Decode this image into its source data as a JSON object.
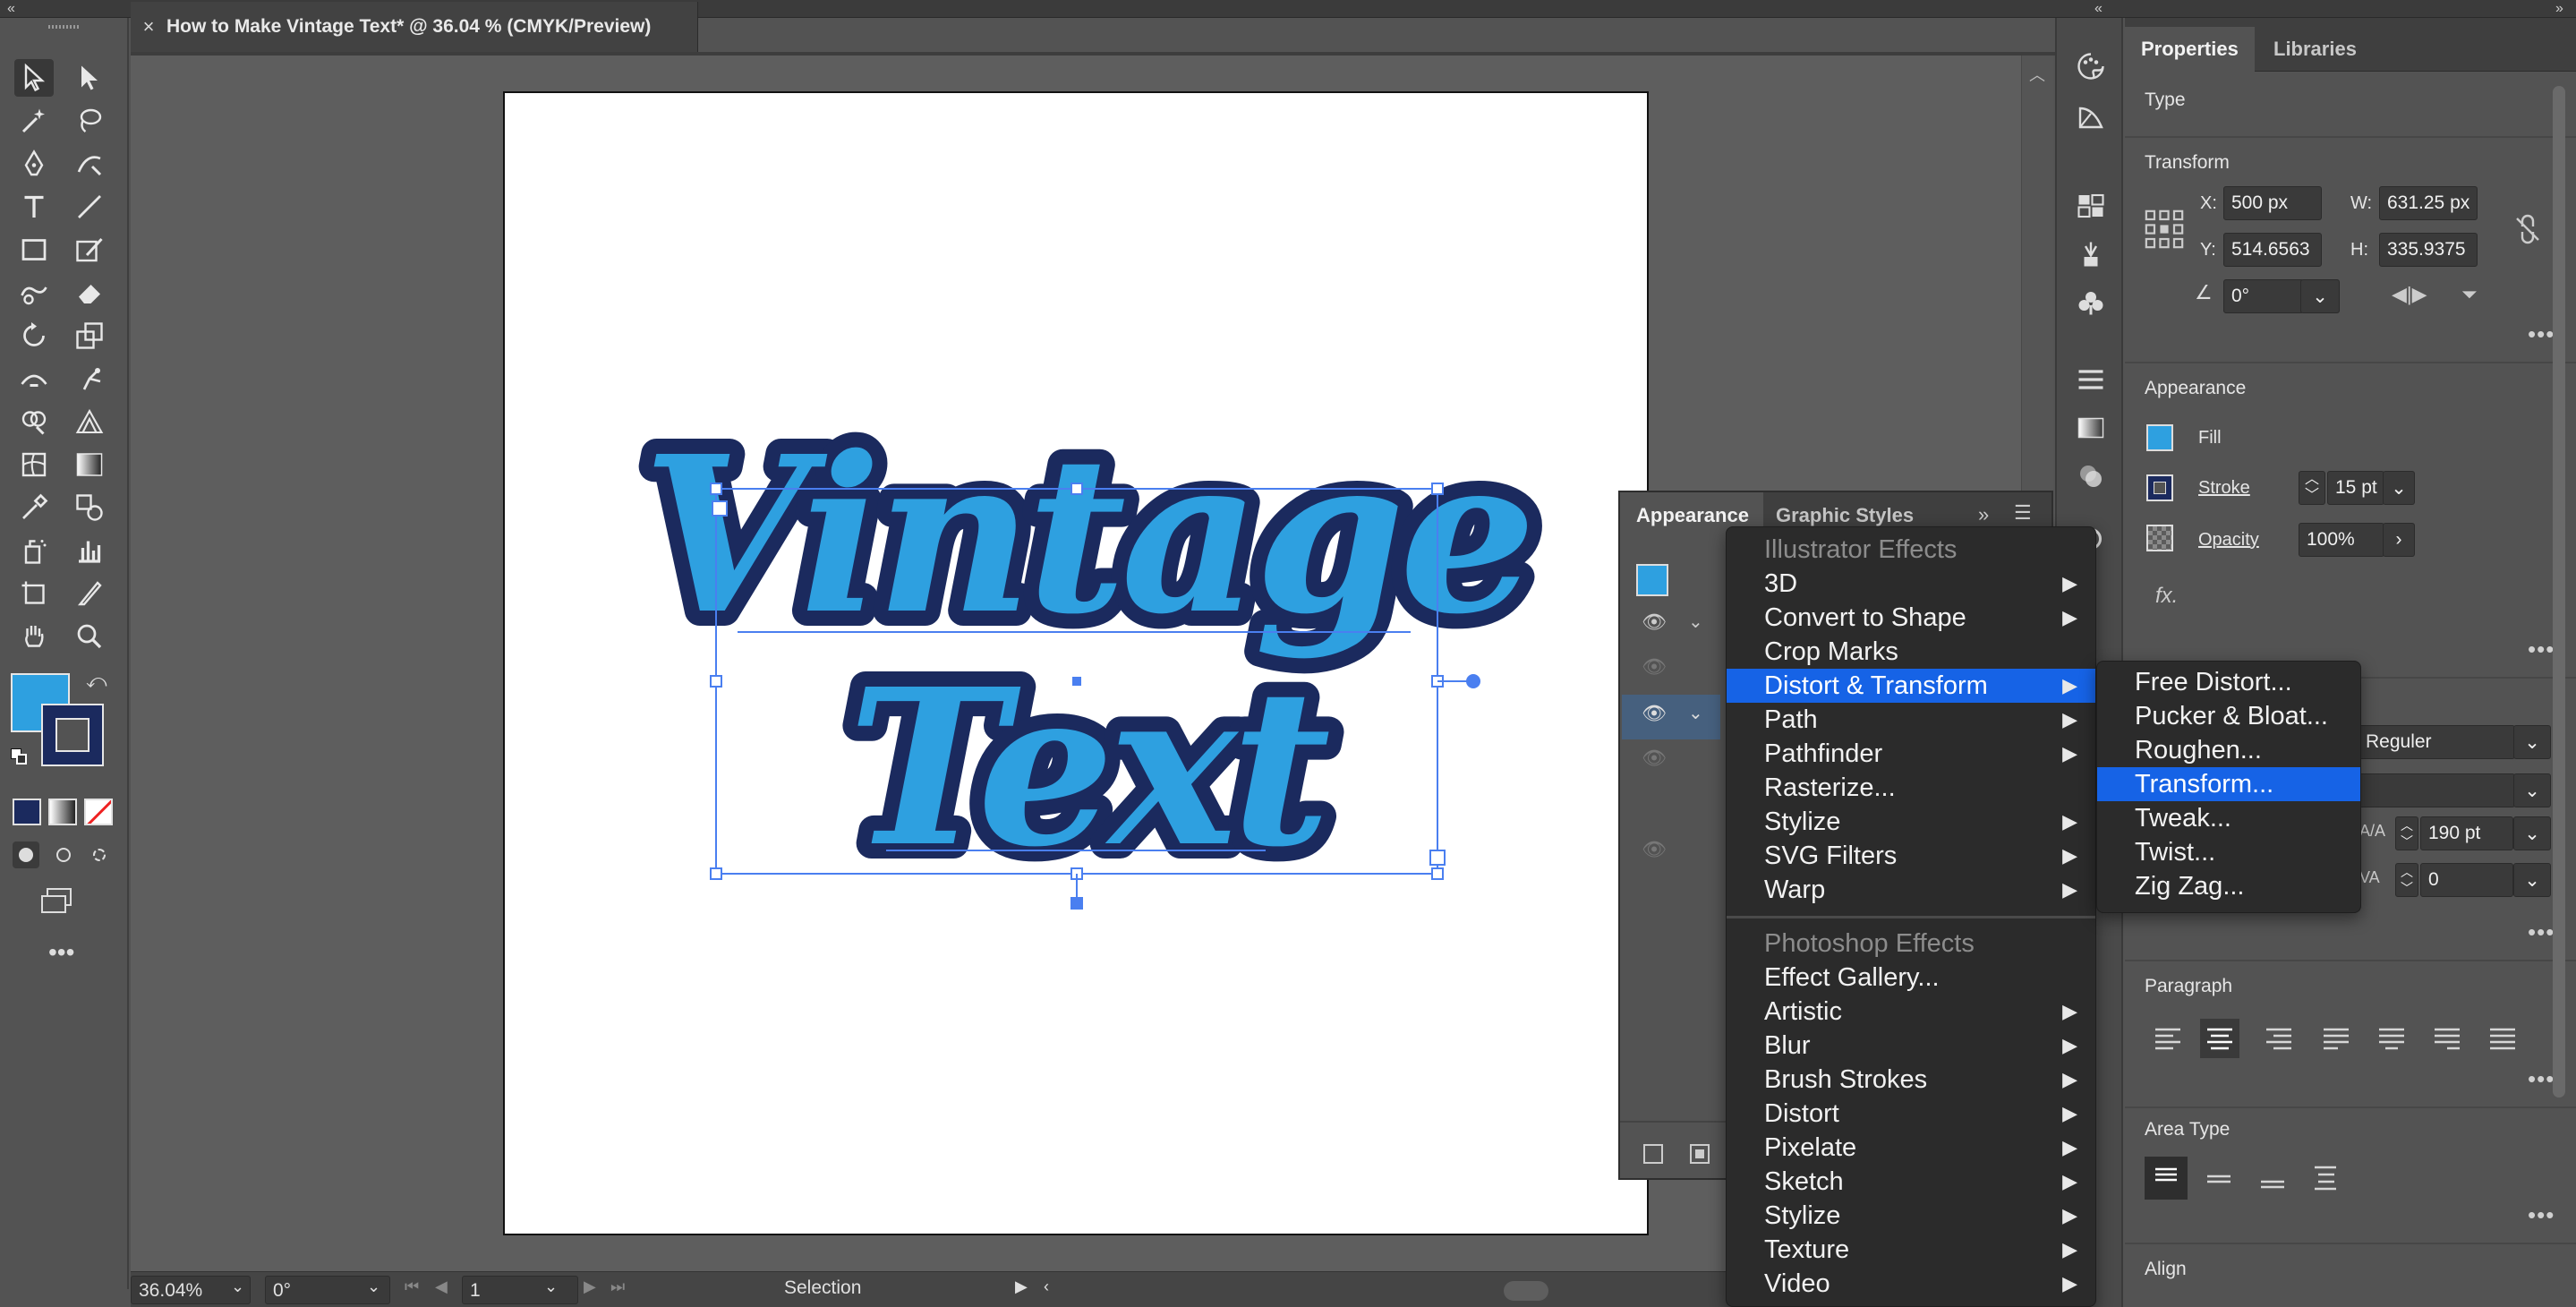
{
  "document": {
    "tab_title": "How to Make Vintage Text* @ 36.04 % (CMYK/Preview)",
    "close": "×"
  },
  "artwork": {
    "line1": "Vintage",
    "line2": "Text",
    "fill_color": "#2ea0e0",
    "stroke_color": "#1b2a5e"
  },
  "status_bar": {
    "zoom": "36.04%",
    "rotation": "0°",
    "artboard": "1",
    "tool": "Selection"
  },
  "properties": {
    "tabs": [
      "Properties",
      "Libraries"
    ],
    "type_label": "Type",
    "transform": {
      "title": "Transform",
      "x_label": "X:",
      "x": "500 px",
      "y_label": "Y:",
      "y": "514.6563",
      "w_label": "W:",
      "w": "631.25 px",
      "h_label": "H:",
      "h": "335.9375",
      "angle": "0°"
    },
    "appearance": {
      "title": "Appearance",
      "fill": "Fill",
      "stroke": "Stroke",
      "stroke_weight": "15 pt",
      "opacity": "Opacity",
      "opacity_value": "100%",
      "fx": "fx."
    },
    "character": {
      "font_style": "Reguler",
      "size": "190 pt",
      "tracking": "0"
    },
    "paragraph_title": "Paragraph",
    "area_type_title": "Area Type",
    "align_title": "Align"
  },
  "appearance_panel": {
    "tabs": [
      "Appearance",
      "Graphic Styles"
    ]
  },
  "effect_menu": {
    "illustrator_header": "Illustrator Effects",
    "illustrator_items": [
      {
        "label": "3D",
        "sub": true
      },
      {
        "label": "Convert to Shape",
        "sub": true
      },
      {
        "label": "Crop Marks",
        "sub": false
      },
      {
        "label": "Distort & Transform",
        "sub": true
      },
      {
        "label": "Path",
        "sub": true
      },
      {
        "label": "Pathfinder",
        "sub": true
      },
      {
        "label": "Rasterize...",
        "sub": false
      },
      {
        "label": "Stylize",
        "sub": true
      },
      {
        "label": "SVG Filters",
        "sub": true
      },
      {
        "label": "Warp",
        "sub": true
      }
    ],
    "photoshop_header": "Photoshop Effects",
    "photoshop_items": [
      {
        "label": "Effect Gallery...",
        "sub": false
      },
      {
        "label": "Artistic",
        "sub": true
      },
      {
        "label": "Blur",
        "sub": true
      },
      {
        "label": "Brush Strokes",
        "sub": true
      },
      {
        "label": "Distort",
        "sub": true
      },
      {
        "label": "Pixelate",
        "sub": true
      },
      {
        "label": "Sketch",
        "sub": true
      },
      {
        "label": "Stylize",
        "sub": true
      },
      {
        "label": "Texture",
        "sub": true
      },
      {
        "label": "Video",
        "sub": true
      }
    ],
    "highlighted": "Distort & Transform",
    "arrow": "▶"
  },
  "distort_submenu": {
    "items": [
      "Free Distort...",
      "Pucker & Bloat...",
      "Roughen...",
      "Transform...",
      "Tweak...",
      "Twist...",
      "Zig Zag..."
    ],
    "highlighted": "Transform..."
  },
  "colors": {
    "menu_highlight": "#1663e6",
    "fill_swatch": "#2ea0e0",
    "stroke_swatch": "#1b2a5e"
  }
}
